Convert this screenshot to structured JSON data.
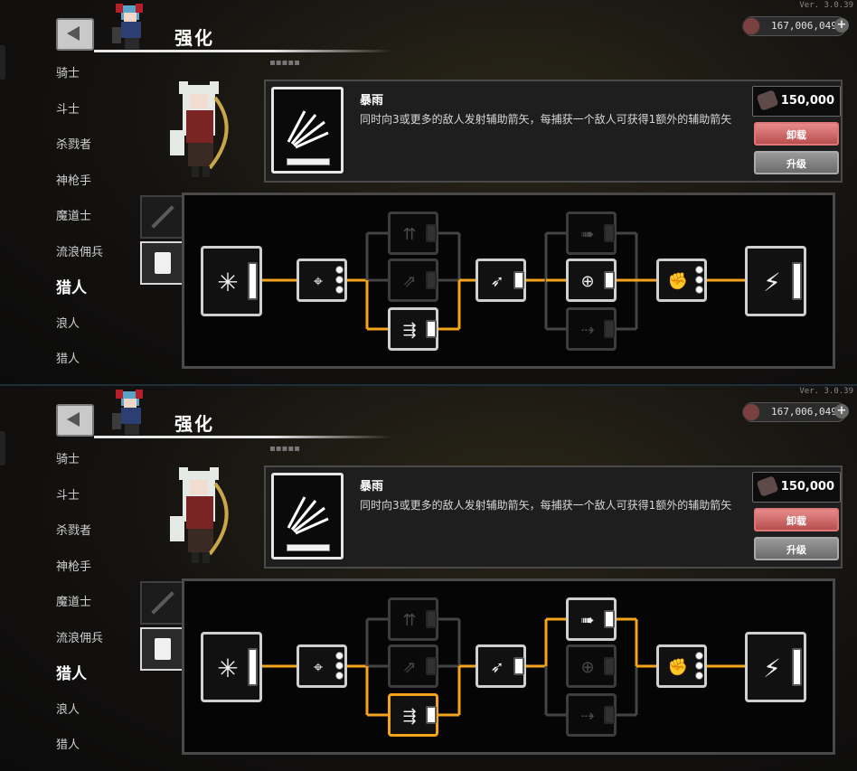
{
  "version": "Ver. 3.0.39",
  "header": {
    "title": "强化",
    "currency": "167,006,049"
  },
  "sidebar": {
    "items": [
      "骑士",
      "斗士",
      "杀戮者",
      "神枪手",
      "魔道士",
      "流浪佣兵",
      "猎人",
      "浪人",
      "猎人"
    ],
    "active_index": 6
  },
  "skill": {
    "name": "暴雨",
    "description": "同时向3或更多的敌人发射辅助箭矢，每捕获一个敌人可获得1额外的辅助箭矢",
    "cost": "150,000",
    "unload_label": "卸载",
    "upgrade_label": "升级"
  },
  "panels": [
    {
      "nodes": [
        "burst-icon",
        "crosshair-icon",
        "quiver-icon",
        "arrows-icon",
        "quiver-arrows-icon",
        "spiral-shot-icon",
        "dash-arrow-icon",
        "target-icon",
        "scatter-icon",
        "gauntlet-icon",
        "lightning-bow-icon"
      ]
    },
    {
      "nodes": [
        "arrow-icon",
        "crosshair-icon",
        "bow-shot-icon",
        "target-bow-icon",
        "arrows-icon",
        "plus-arrow-icon",
        "claw-icon",
        "multi-arrow-icon",
        "broken-bow-icon",
        "rising-arrow-icon",
        "burst-icon"
      ]
    }
  ]
}
